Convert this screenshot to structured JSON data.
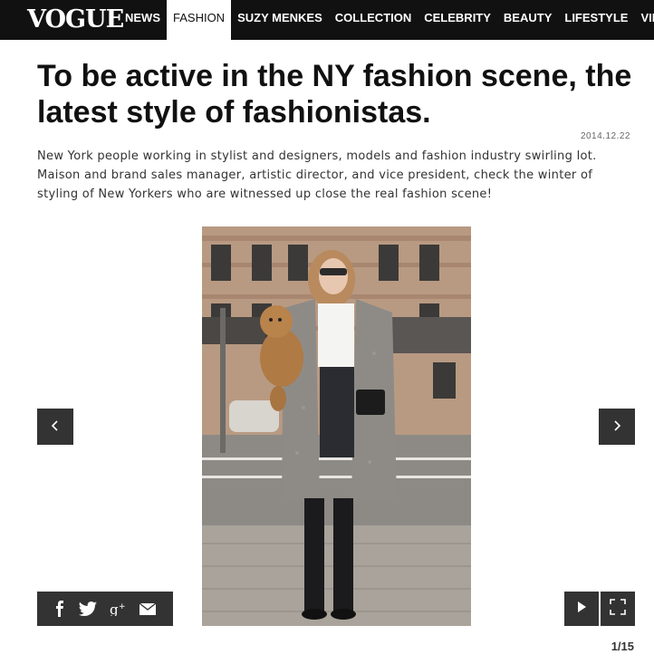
{
  "brand": {
    "logo": "VOGUE"
  },
  "nav": [
    {
      "label": "NEWS"
    },
    {
      "label": "FASHION"
    },
    {
      "label": "SUZY MENKES"
    },
    {
      "label": "COLLECTION"
    },
    {
      "label": "CELEBRITY"
    },
    {
      "label": "BEAUTY"
    },
    {
      "label": "LIFESTYLE"
    },
    {
      "label": "VIDEOS"
    }
  ],
  "article": {
    "title": "To be active in the NY fashion scene, the latest style of fashionistas.",
    "date": "2014.12.22",
    "lede": "New York people working in stylist and designers, models and fashion industry swirling lot. Maison and brand sales manager, artistic director, and vice president, check the winter of styling of New Yorkers who are witnessed up close the real fashion scene!"
  },
  "gallery": {
    "prev_icon": "chevron-left-icon",
    "next_icon": "chevron-right-icon",
    "counter": "1/15",
    "share_icons": [
      "facebook-icon",
      "twitter-icon",
      "google-plus-icon",
      "mail-icon"
    ],
    "controls": [
      "play-icon",
      "fullscreen-icon"
    ]
  }
}
